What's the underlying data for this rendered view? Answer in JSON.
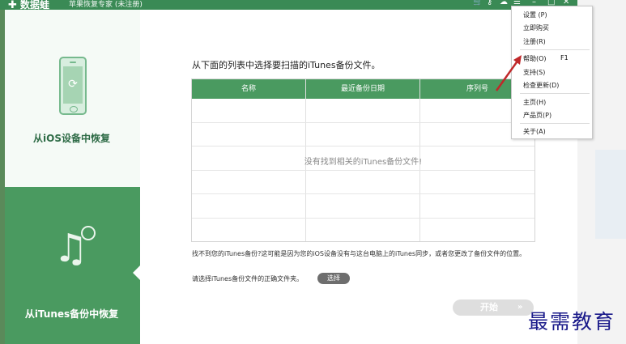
{
  "titlebar": {
    "logo_mark": "✚",
    "logo_text": "数据蛙",
    "app_title": "苹果恢复专家 (未注册)",
    "icons": {
      "cart": "🛒",
      "key": "⚷",
      "chat": "☁",
      "menu": "☰",
      "minimize": "–",
      "maximize": "□",
      "close": "✕"
    }
  },
  "sidebar": {
    "ios_label": "从iOS设备中恢复",
    "ios_icon": "phone-refresh-icon",
    "itunes_label": "从iTunes备份中恢复",
    "itunes_icon": "music-note-refresh-icon"
  },
  "main": {
    "instruction": "从下面的列表中选择要扫描的iTunes备份文件。",
    "table": {
      "headers": [
        "名称",
        "最近备份日期",
        "序列号"
      ],
      "empty_message": "没有找到相关的iTunes备份文件!"
    },
    "note": "找不到您的iTunes备份?这可能是因为您的iOS设备没有与这台电脑上的iTunes同步，或者您更改了备份文件的位置。",
    "choose_prompt": "请选择iTunes备份文件的正确文件夹。",
    "choose_button": "选择",
    "start_button": "开始",
    "start_arrows": "»"
  },
  "menu": {
    "items": [
      {
        "label": "设置 (P)",
        "shortcut": ""
      },
      {
        "label": "立即购买",
        "shortcut": ""
      },
      {
        "label": "注册(R)",
        "shortcut": ""
      },
      {
        "label": "帮助(O)",
        "shortcut": "F1"
      },
      {
        "label": "支持(S)",
        "shortcut": ""
      },
      {
        "label": "检查更新(D)",
        "shortcut": ""
      },
      {
        "label": "主页(H)",
        "shortcut": ""
      },
      {
        "label": "产品页(P)",
        "shortcut": ""
      },
      {
        "label": "关于(A)",
        "shortcut": ""
      }
    ]
  },
  "watermark": "最需教育",
  "colors": {
    "brand_green": "#3a8a55",
    "header_green": "#4a9a60",
    "annotation_red": "#c0282a",
    "watermark_blue": "#1a1a8a"
  }
}
